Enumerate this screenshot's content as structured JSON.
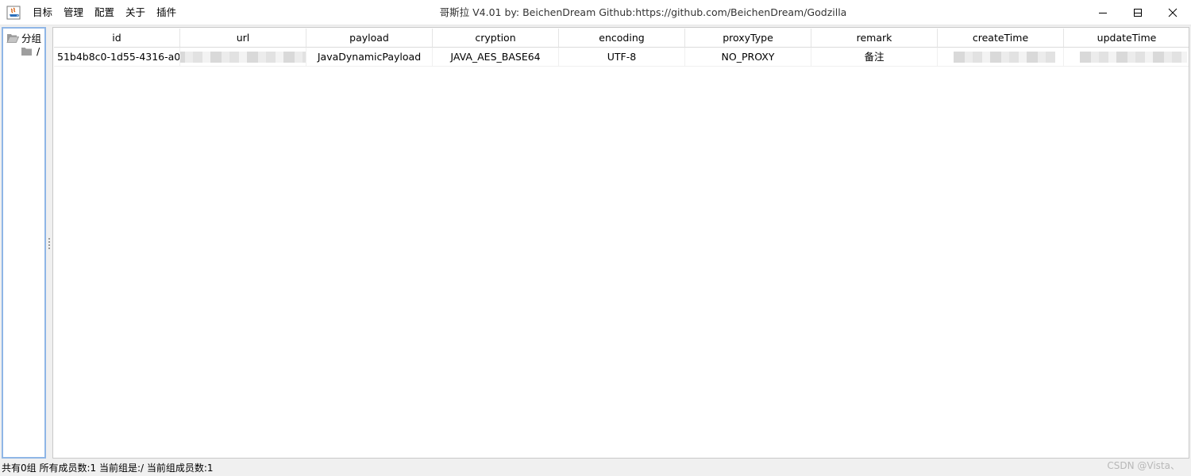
{
  "window": {
    "title": "哥斯拉   V4.01 by: BeichenDream Github:https://github.com/BeichenDream/Godzilla"
  },
  "menu": [
    {
      "label": "目标"
    },
    {
      "label": "管理"
    },
    {
      "label": "配置"
    },
    {
      "label": "关于"
    },
    {
      "label": "插件"
    }
  ],
  "tree": {
    "root": {
      "label": "分组",
      "icon": "folder-open-icon"
    },
    "child": {
      "label": "/",
      "icon": "folder-icon"
    }
  },
  "table": {
    "columns": [
      "id",
      "url",
      "payload",
      "cryption",
      "encoding",
      "proxyType",
      "remark",
      "createTime",
      "updateTime"
    ],
    "rows": [
      {
        "id": "51b4b8c0-1d55-4316-a0...",
        "url": "",
        "payload": "JavaDynamicPayload",
        "cryption": "JAVA_AES_BASE64",
        "encoding": "UTF-8",
        "proxyType": "NO_PROXY",
        "remark": "备注",
        "createTime": "",
        "updateTime": ""
      }
    ]
  },
  "status": {
    "text": "共有0组 所有成员数:1 当前组是:/ 当前组成员数:1"
  },
  "watermark": "CSDN @Vista、",
  "colors": {
    "accent_border": "#8fb6e6",
    "close_hover": "#e81123"
  }
}
